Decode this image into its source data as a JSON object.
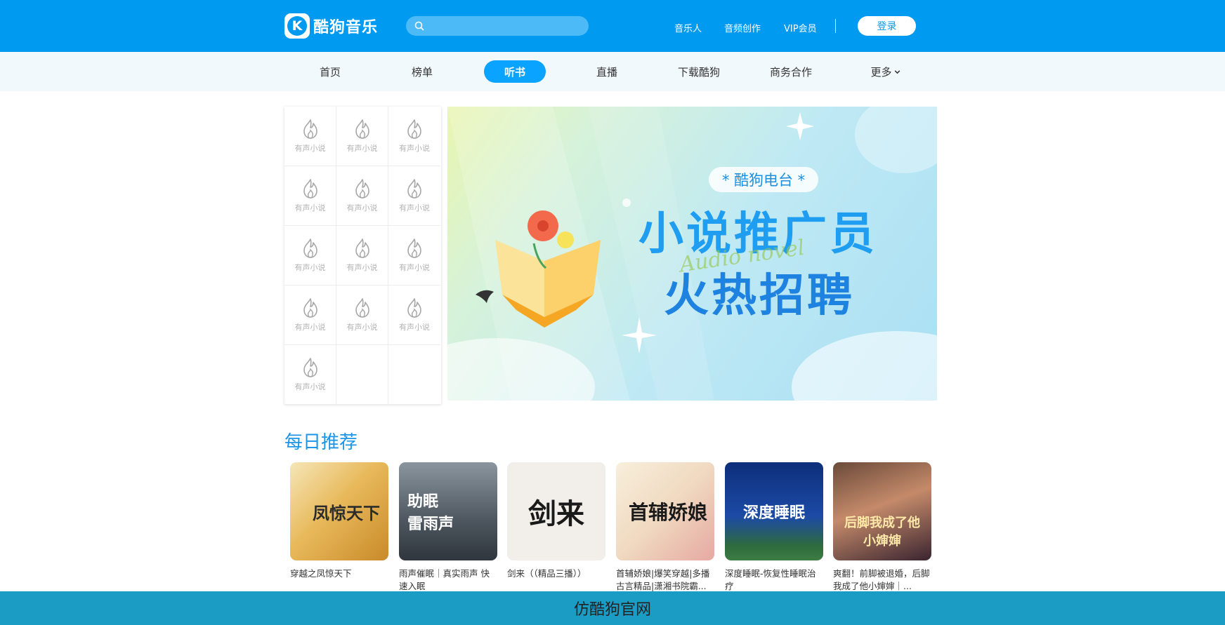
{
  "header": {
    "logo_text": "酷狗音乐",
    "logo_mark": "K",
    "search": {
      "placeholder": "",
      "value": ""
    },
    "links": [
      "音乐人",
      "音频创作",
      "VIP会员"
    ],
    "login_label": "登录"
  },
  "nav": {
    "items": [
      "首页",
      "榜单",
      "听书",
      "直播",
      "下载酷狗",
      "商务合作",
      "更多"
    ],
    "active_index": 2
  },
  "categories": {
    "items": [
      "有声小说",
      "有声小说",
      "有声小说",
      "有声小说",
      "有声小说",
      "有声小说",
      "有声小说",
      "有声小说",
      "有声小说",
      "有声小说",
      "有声小说",
      "有声小说",
      "有声小说"
    ],
    "icon": "flame-icon"
  },
  "banner": {
    "pill": "* 酷狗电台 *",
    "line1": "小说推广员",
    "line2": "火热招聘",
    "subtitle": "Audio novel"
  },
  "recommend": {
    "title": "每日推荐",
    "cards": [
      {
        "title": "穿越之凤惊天下",
        "cover_text": "凤惊天下"
      },
      {
        "title": "雨声催眠｜真实雨声 快速入眠",
        "cover_text": "助眠 雷雨声"
      },
      {
        "title": "剑来（（精品三播））",
        "cover_text": "剑来"
      },
      {
        "title": "首辅娇娘|爆笑穿越|多播古言精品|潇湘书院霸...",
        "cover_text": "首辅娇娘"
      },
      {
        "title": "深度睡眠-恢复性睡眠治疗",
        "cover_text": "深度睡眠"
      },
      {
        "title": "爽翻！前脚被退婚，后脚我成了他小婶婶｜...",
        "cover_text": "后脚我成了他小婶婶"
      }
    ]
  },
  "footer": {
    "text": "仿酷狗官网"
  },
  "colors": {
    "brand": "#009af0",
    "nav_bg": "#f2f9fd",
    "active": "#0aa3ff",
    "footer": "#1b9cc4"
  }
}
